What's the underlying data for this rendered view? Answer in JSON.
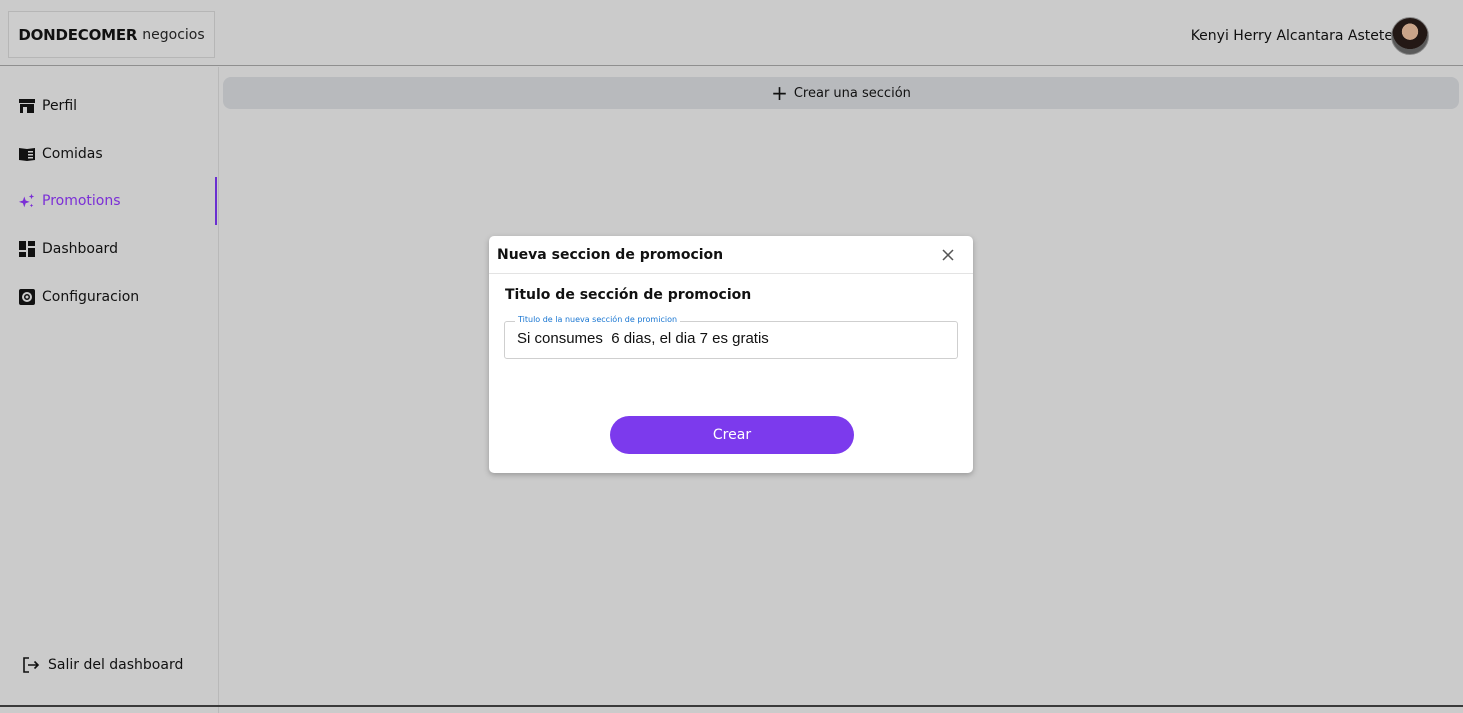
{
  "header": {
    "brand_bold": "DONDECOMER",
    "brand_light": "negocios",
    "user_name": "Kenyi Herry Alcantara Astete"
  },
  "sidebar": {
    "items": [
      {
        "label": "Perfil",
        "icon": "store-icon"
      },
      {
        "label": "Comidas",
        "icon": "menu-book-icon"
      },
      {
        "label": "Promotions",
        "icon": "sparkles-icon",
        "active": true
      },
      {
        "label": "Dashboard",
        "icon": "dashboard-icon"
      },
      {
        "label": "Configuracion",
        "icon": "settings-icon"
      }
    ],
    "logout_label": "Salir del dashboard"
  },
  "main": {
    "create_section_label": "Crear una sección"
  },
  "modal": {
    "title": "Nueva seccion de promocion",
    "section_label": "Titulo de sección de promocion",
    "field_label": "Titulo de la nueva sección de promicion",
    "field_value": "Si consumes  6 dias, el dia 7 es gratis",
    "submit_label": "Crear"
  },
  "colors": {
    "accent": "#7c3aed",
    "active_nav": "#7b2fd6",
    "background": "#cbcbcb",
    "field_label": "#1976d2"
  }
}
